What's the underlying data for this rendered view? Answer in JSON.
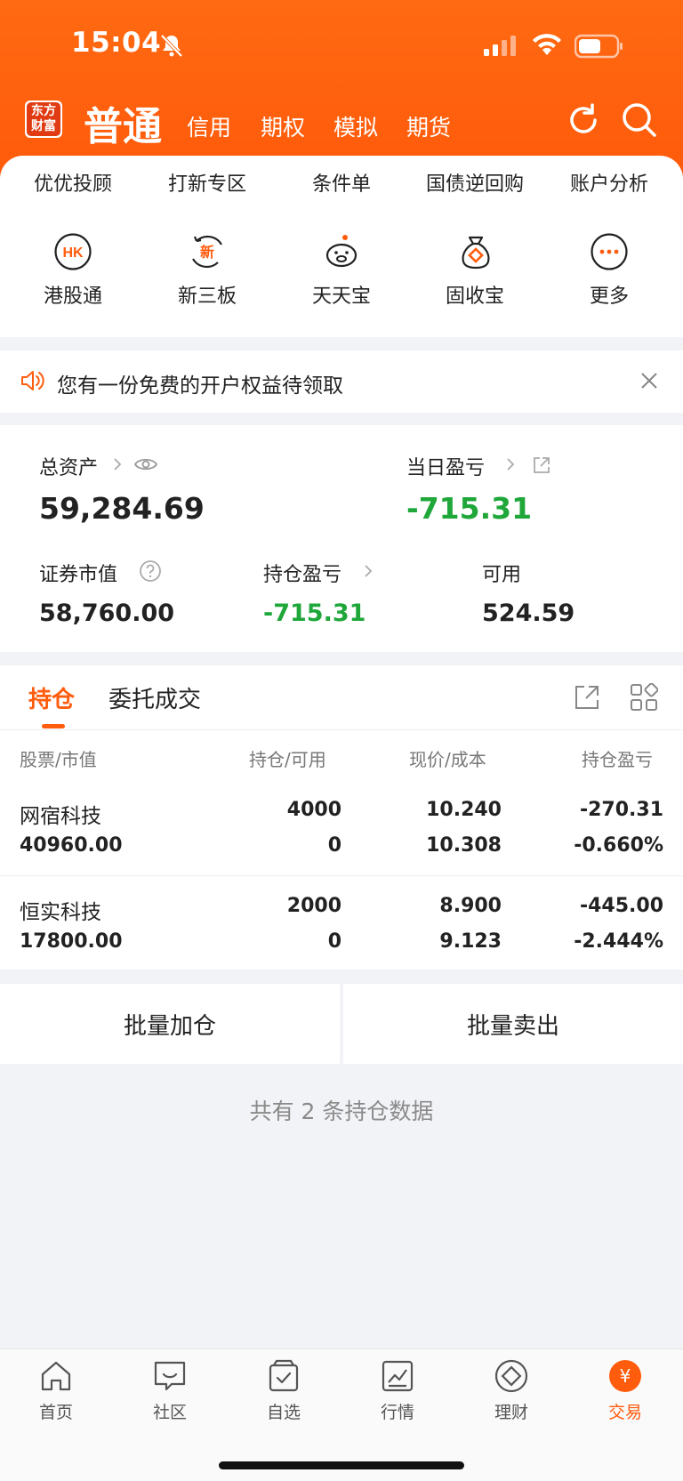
{
  "status_bar": {
    "time": "15:04"
  },
  "header": {
    "logo_text": "东方财富",
    "account_type": "普通",
    "tabs": [
      "信用",
      "期权",
      "模拟",
      "期货"
    ],
    "icons": [
      "refresh-icon",
      "search-icon"
    ]
  },
  "quick_links": [
    "优优投顾",
    "打新专区",
    "条件单",
    "国债逆回购",
    "账户分析"
  ],
  "quick_icons": [
    {
      "label": "港股通",
      "icon": "hk-icon",
      "glyph": "HK"
    },
    {
      "label": "新三板",
      "icon": "new-board-icon",
      "glyph": "新"
    },
    {
      "label": "天天宝",
      "icon": "piggy-bank-icon"
    },
    {
      "label": "固收宝",
      "icon": "money-bag-icon"
    },
    {
      "label": "更多",
      "icon": "more-icon"
    }
  ],
  "notice": {
    "text": "您有一份免费的开户权益待领取"
  },
  "assets": {
    "total_label": "总资产",
    "total_value": "59,284.69",
    "daily_pnl_label": "当日盈亏",
    "daily_pnl_value": "-715.31",
    "market_value_label": "证券市值",
    "market_value": "58,760.00",
    "position_pnl_label": "持仓盈亏",
    "position_pnl_value": "-715.31",
    "available_label": "可用",
    "available_value": "524.59"
  },
  "holdings": {
    "tabs": [
      "持仓",
      "委托成交"
    ],
    "columns": [
      "股票/市值",
      "持仓/可用",
      "现价/成本",
      "持仓盈亏"
    ],
    "rows": [
      {
        "name": "网宿科技",
        "market_value": "40960.00",
        "position": "4000",
        "available": "0",
        "price": "10.240",
        "cost": "10.308",
        "pnl": "-270.31",
        "pnl_pct": "-0.660%"
      },
      {
        "name": "恒实科技",
        "market_value": "17800.00",
        "position": "2000",
        "available": "0",
        "price": "8.900",
        "cost": "9.123",
        "pnl": "-445.00",
        "pnl_pct": "-2.444%"
      }
    ]
  },
  "batch": {
    "add": "批量加仓",
    "sell": "批量卖出"
  },
  "summary": "共有 2 条持仓数据",
  "bottom_nav": [
    {
      "label": "首页",
      "icon": "home-icon"
    },
    {
      "label": "社区",
      "icon": "community-icon"
    },
    {
      "label": "自选",
      "icon": "watchlist-icon"
    },
    {
      "label": "行情",
      "icon": "market-icon"
    },
    {
      "label": "理财",
      "icon": "wealth-icon"
    },
    {
      "label": "交易",
      "icon": "trade-icon",
      "active": true
    }
  ],
  "colors": {
    "brand": "#ff5c0e",
    "gain_loss_green": "#1fa73a"
  }
}
